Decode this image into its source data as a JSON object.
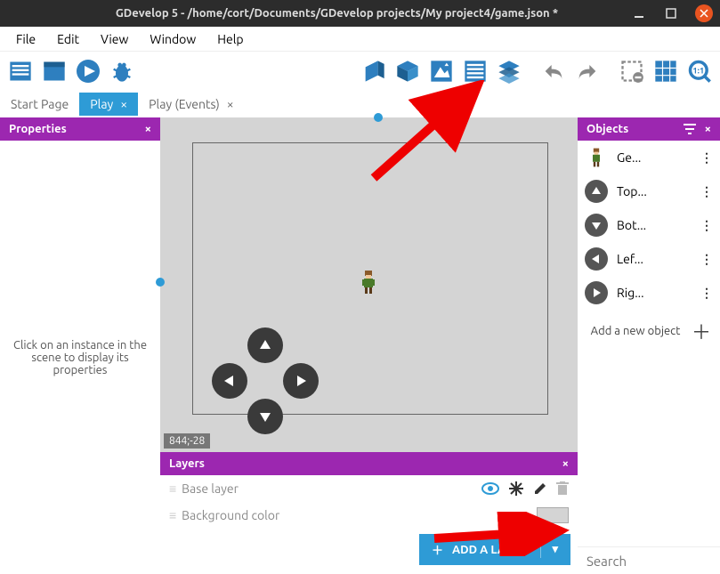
{
  "window": {
    "title": "GDevelop 5 - /home/cort/Documents/GDevelop projects/My project4/game.json *"
  },
  "menu": {
    "items": [
      "File",
      "Edit",
      "View",
      "Window",
      "Help"
    ]
  },
  "tabs": [
    {
      "label": "Start Page",
      "active": false,
      "closable": false
    },
    {
      "label": "Play",
      "active": true,
      "closable": true
    },
    {
      "label": "Play (Events)",
      "active": false,
      "closable": true
    }
  ],
  "panels": {
    "properties": {
      "title": "Properties",
      "placeholder": "Click on an instance in the scene to display its properties"
    },
    "objects": {
      "title": "Objects",
      "items": [
        {
          "kind": "sprite",
          "label": "Ge..."
        },
        {
          "kind": "arrow-up",
          "label": "Top..."
        },
        {
          "kind": "arrow-down",
          "label": "Bot..."
        },
        {
          "kind": "arrow-left",
          "label": "Lef..."
        },
        {
          "kind": "arrow-right",
          "label": "Rig..."
        }
      ],
      "add_label": "Add a new object",
      "search_placeholder": "Search"
    },
    "layers": {
      "title": "Layers",
      "rows": [
        {
          "label": "Base layer",
          "type": "layer"
        },
        {
          "label": "Background color",
          "type": "bgcolor"
        }
      ],
      "add_button": "ADD A LAYER"
    }
  },
  "scene": {
    "coord_label": "844;-28"
  },
  "colors": {
    "accent": "#2e9bd6",
    "purple": "#9c27b0",
    "canvas": "#d4d4d4"
  }
}
